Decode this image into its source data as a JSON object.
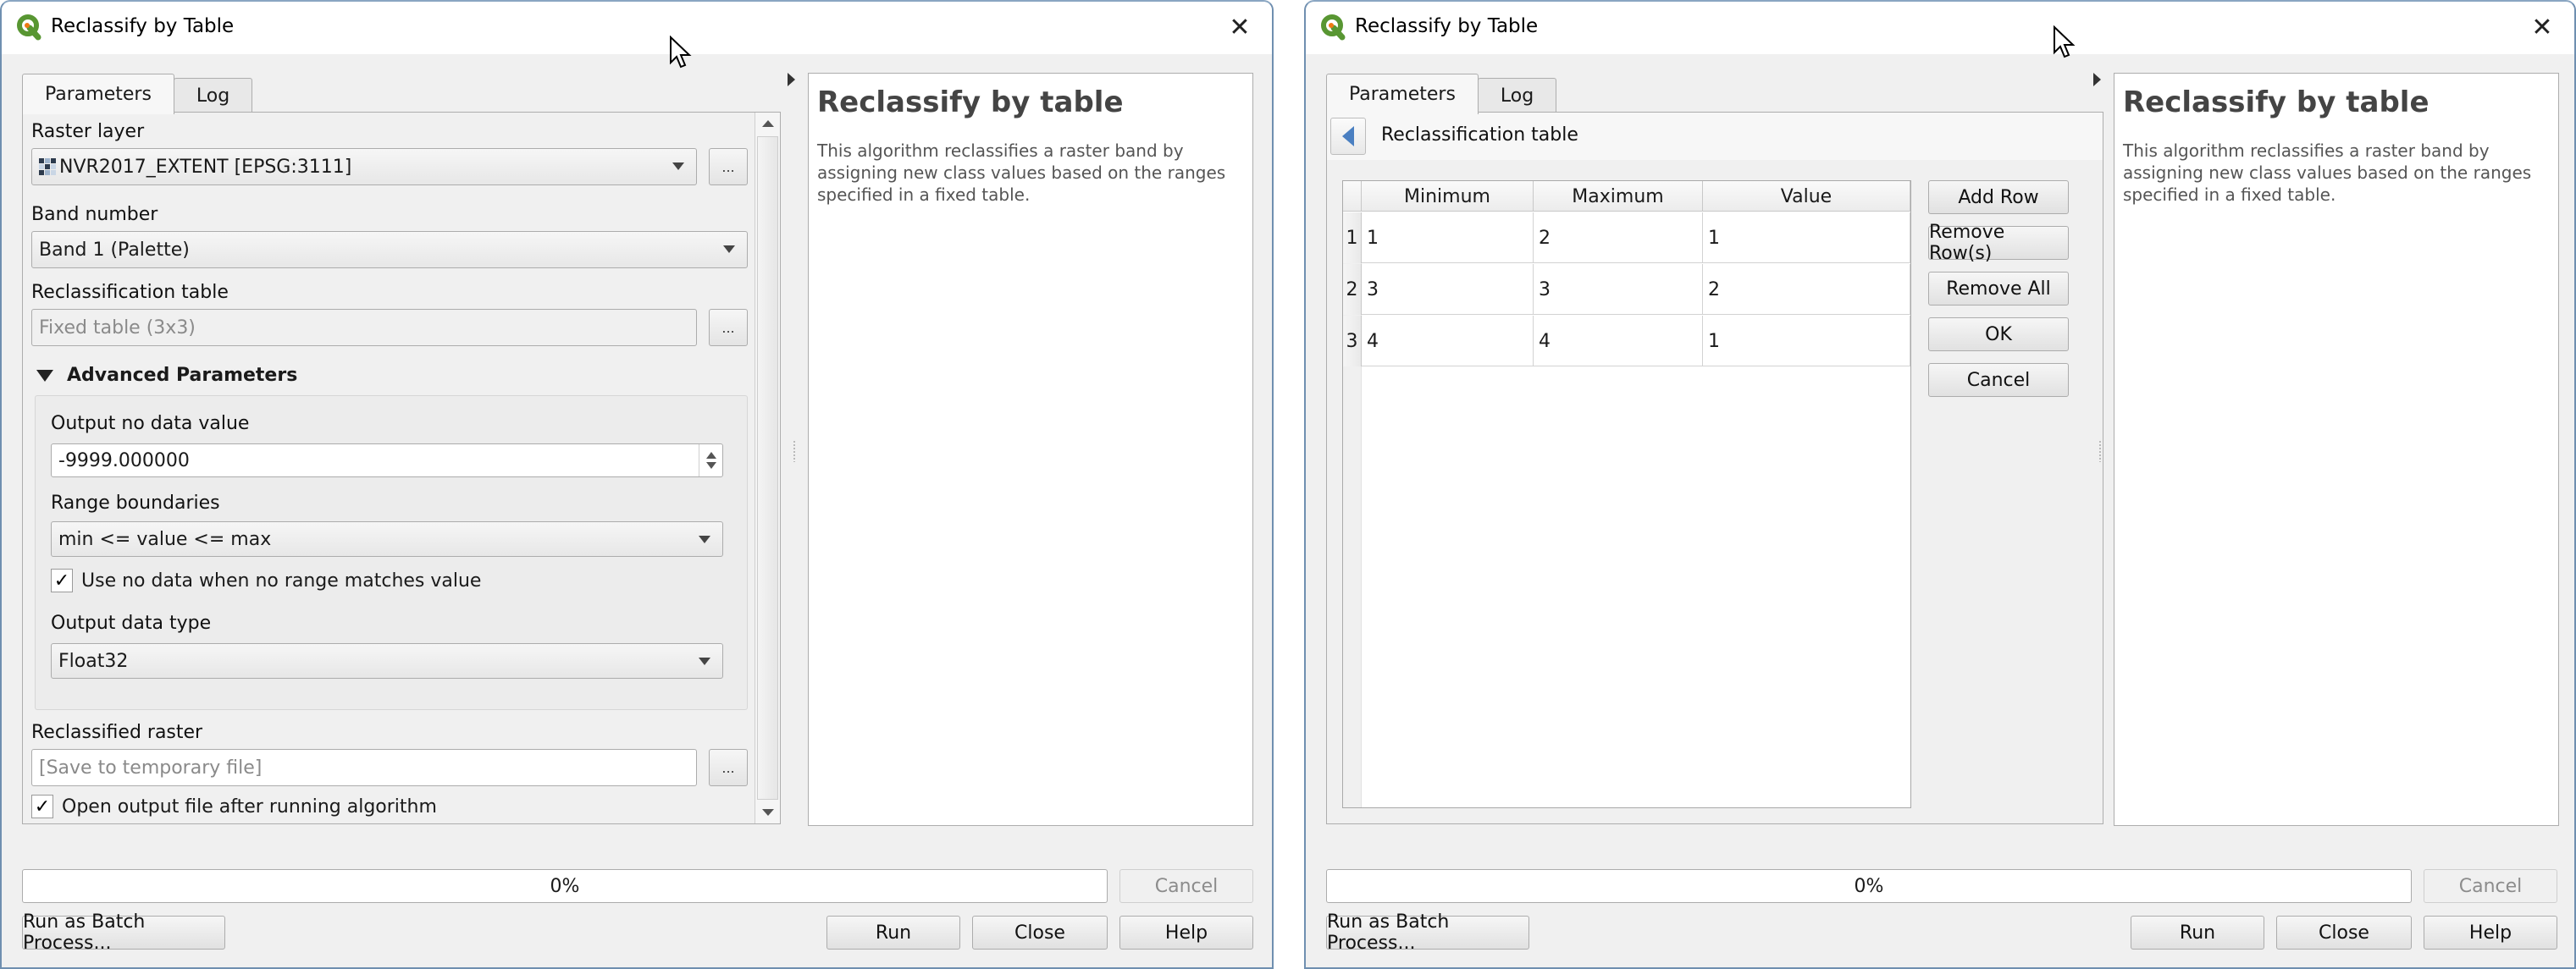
{
  "dialogs": {
    "left": {
      "title": "Reclassify by Table",
      "close_glyph": "✕",
      "tabs": [
        {
          "label": "Parameters",
          "active": true
        },
        {
          "label": "Log",
          "active": false
        }
      ],
      "params": {
        "raster_layer": {
          "label": "Raster layer",
          "value": "NVR2017_EXTENT [EPSG:3111]",
          "icon": "raster-layer-icon",
          "browse_label": "..."
        },
        "band_number": {
          "label": "Band number",
          "value": "Band 1 (Palette)"
        },
        "reclass_table": {
          "label": "Reclassification table",
          "value": "Fixed table (3x3)",
          "browse_label": "..."
        },
        "advanced": {
          "header": "Advanced Parameters",
          "expanded": true,
          "nodata": {
            "label": "Output no data value",
            "value": "-9999.000000"
          },
          "range_boundaries": {
            "label": "Range boundaries",
            "value": "min <= value <= max"
          },
          "use_nodata": {
            "label": "Use no data when no range matches value",
            "checked": true
          },
          "data_type": {
            "label": "Output data type",
            "value": "Float32"
          }
        },
        "reclassified_raster": {
          "label": "Reclassified raster",
          "placeholder": "[Save to temporary file]",
          "browse_label": "..."
        },
        "open_output": {
          "label": "Open output file after running algorithm",
          "checked": true
        }
      },
      "description": {
        "title": "Reclassify by table",
        "text": "This algorithm reclassifies a raster band by assigning new class values based on the ranges specified in a fixed table."
      },
      "progress": {
        "value_percent": 0,
        "label": "0%"
      },
      "buttons": {
        "cancel": "Cancel",
        "batch": "Run as Batch Process...",
        "run": "Run",
        "close": "Close",
        "help": "Help"
      }
    },
    "right": {
      "title": "Reclassify by Table",
      "close_glyph": "✕",
      "tabs": [
        {
          "label": "Parameters",
          "active": true
        },
        {
          "label": "Log",
          "active": false
        }
      ],
      "panel_title": "Reclassification table",
      "table": {
        "columns": [
          "Minimum",
          "Maximum",
          "Value"
        ],
        "rows": [
          {
            "num": "1",
            "min": "1",
            "max": "2",
            "value": "1"
          },
          {
            "num": "2",
            "min": "3",
            "max": "3",
            "value": "2"
          },
          {
            "num": "3",
            "min": "4",
            "max": "4",
            "value": "1"
          }
        ]
      },
      "table_buttons": {
        "add_row": "Add Row",
        "remove_rows": "Remove Row(s)",
        "remove_all": "Remove All",
        "ok": "OK",
        "cancel": "Cancel"
      },
      "description": {
        "title": "Reclassify by table",
        "text": "This algorithm reclassifies a raster band by assigning new class values based on the ranges specified in a fixed table."
      },
      "progress": {
        "value_percent": 0,
        "label": "0%"
      },
      "buttons": {
        "cancel": "Cancel",
        "batch": "Run as Batch Process...",
        "run": "Run",
        "close": "Close",
        "help": "Help"
      }
    }
  },
  "colors": {
    "qgis_green": "#589632",
    "qgis_orange": "#ee7913",
    "back_arrow_blue": "#4a7fc1",
    "window_border": "#6f8fb0"
  }
}
